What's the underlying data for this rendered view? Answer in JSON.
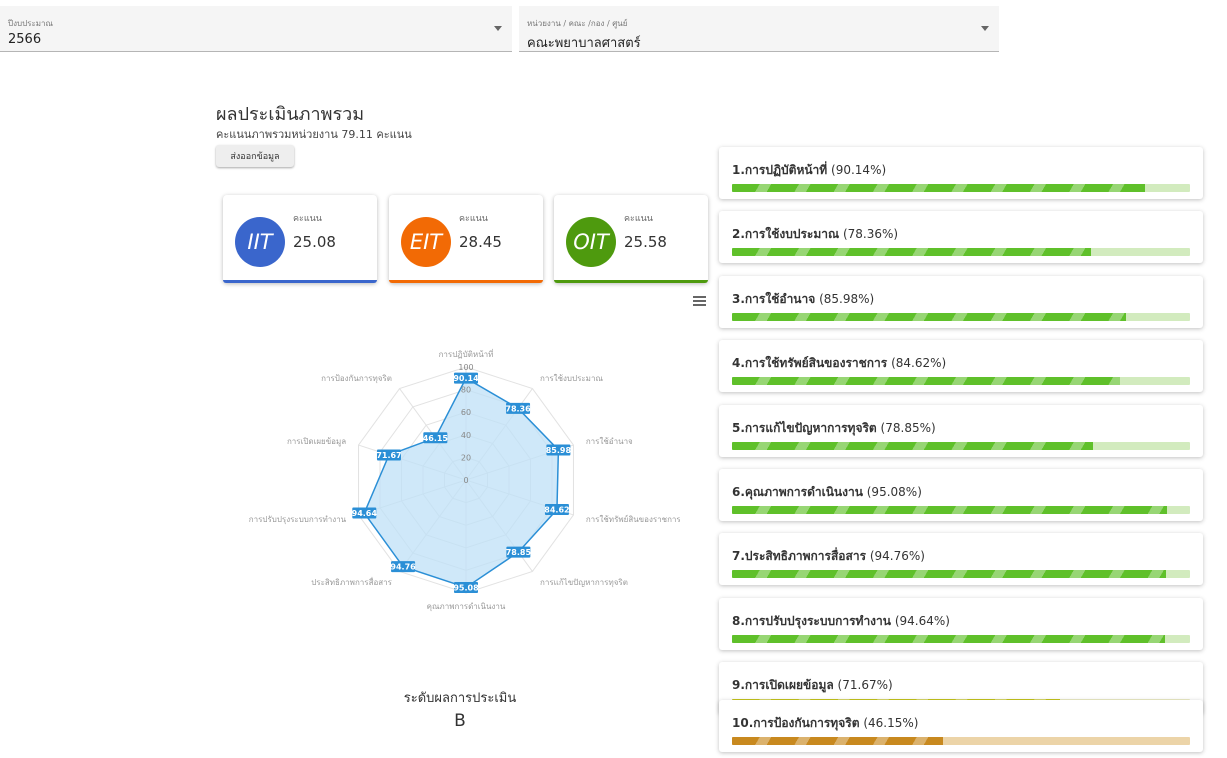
{
  "filters": {
    "year": {
      "label": "ปีงบประมาณ",
      "value": "2566"
    },
    "unit": {
      "label": "หน่วยงาน / คณะ /กอง / ศูนย์",
      "value": "คณะพยาบาลศาสตร์"
    }
  },
  "overall": {
    "title": "ผลประเมินภาพรวม",
    "score_text": "คะแนนภาพรวมหน่วยงาน 79.11 คะแนน",
    "export_label": "ส่งออกข้อมูล"
  },
  "cards": [
    {
      "abbr": "IIT",
      "title": "คะแนน",
      "value": "25.08",
      "color": "#3a66cc"
    },
    {
      "abbr": "EIT",
      "title": "คะแนน",
      "value": "28.45",
      "color": "#f26a05"
    },
    {
      "abbr": "OIT",
      "title": "คะแนน",
      "value": "25.58",
      "color": "#4e9a0e"
    }
  ],
  "chart_data": {
    "type": "radar",
    "categories": [
      "การปฏิบัติหน้าที่",
      "การใช้งบประมาณ",
      "การใช้อำนาจ",
      "การใช้ทรัพย์สินของราชการ",
      "การแก้ไขปัญหาการทุจริต",
      "คุณภาพการดำเนินงาน",
      "ประสิทธิภาพการสื่อสาร",
      "การปรับปรุงระบบการทำงาน",
      "การเปิดเผยข้อมูล",
      "การป้องกันการทุจริต"
    ],
    "values": [
      90.14,
      78.36,
      85.98,
      84.62,
      78.85,
      95.08,
      94.76,
      94.64,
      71.67,
      46.15
    ],
    "ticks": [
      "0",
      "20",
      "40",
      "60",
      "80",
      "100"
    ],
    "ylim": [
      0,
      100
    ],
    "line_color": "#2b8fd6",
    "fill_color": "#bfe0f7"
  },
  "level": {
    "label": "ระดับผลการประเมิน",
    "value": "B"
  },
  "indicators": [
    {
      "name": "1.การปฏิบัติหน้าที่",
      "pct_text": "(90.14%)",
      "value": 90.14,
      "color": "#5fc02a",
      "track": "#d2ebbe"
    },
    {
      "name": "2.การใช้งบประมาณ",
      "pct_text": "(78.36%)",
      "value": 78.36,
      "color": "#5fc02a",
      "track": "#d2ebbe"
    },
    {
      "name": "3.การใช้อำนาจ",
      "pct_text": "(85.98%)",
      "value": 85.98,
      "color": "#5fc02a",
      "track": "#d2ebbe"
    },
    {
      "name": "4.การใช้ทรัพย์สินของราชการ",
      "pct_text": "(84.62%)",
      "value": 84.62,
      "color": "#5fc02a",
      "track": "#d2ebbe"
    },
    {
      "name": "5.การแก้ไขปัญหาการทุจริต",
      "pct_text": "(78.85%)",
      "value": 78.85,
      "color": "#5fc02a",
      "track": "#d2ebbe"
    },
    {
      "name": "6.คุณภาพการดำเนินงาน",
      "pct_text": "(95.08%)",
      "value": 95.08,
      "color": "#5fc02a",
      "track": "#d2ebbe"
    },
    {
      "name": "7.ประสิทธิภาพการสื่อสาร",
      "pct_text": "(94.76%)",
      "value": 94.76,
      "color": "#5fc02a",
      "track": "#d2ebbe"
    },
    {
      "name": "8.การปรับปรุงระบบการทำงาน",
      "pct_text": "(94.64%)",
      "value": 94.64,
      "color": "#5fc02a",
      "track": "#d2ebbe"
    },
    {
      "name": "9.การเปิดเผยข้อมูล",
      "pct_text": "(71.67%)",
      "value": 71.67,
      "color": "#c6c61c",
      "track": "#eeeec8"
    },
    {
      "name": "10.การป้องกันการทุจริต",
      "pct_text": "(46.15%)",
      "value": 46.15,
      "color": "#c8891f",
      "track": "#ecd4a8"
    }
  ]
}
